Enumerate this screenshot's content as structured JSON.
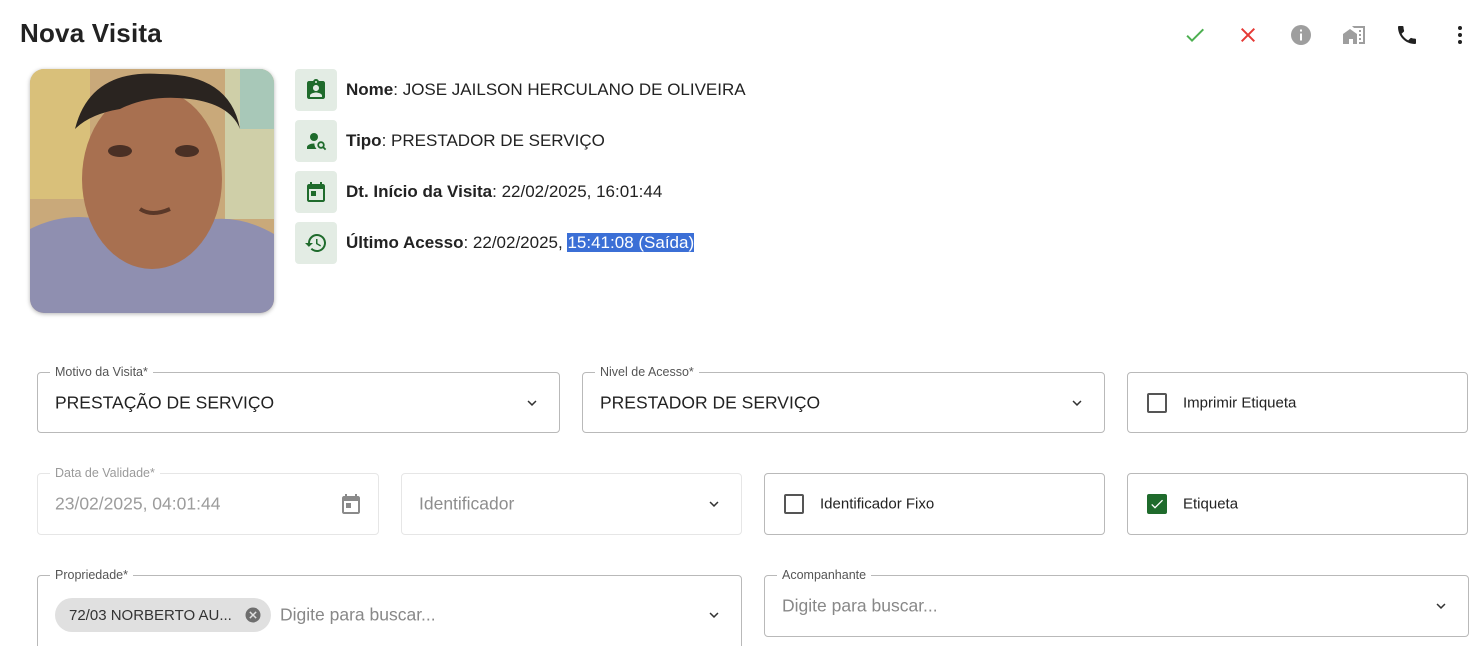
{
  "header": {
    "title": "Nova Visita",
    "actions": [
      "check-icon",
      "close-icon",
      "info-icon",
      "home-work-icon",
      "phone-icon",
      "more-vert-icon"
    ]
  },
  "visitor": {
    "name_label": "Nome",
    "name": "JOSE JAILSON HERCULANO DE OLIVEIRA",
    "type_label": "Tipo",
    "type": "PRESTADOR DE SERVIÇO",
    "start_label": "Dt. Início da Visita",
    "start": "22/02/2025, 16:01:44",
    "last_label": "Último Acesso",
    "last_prefix": "22/02/2025,",
    "last_selected": "15:41:08 (Saída)"
  },
  "form": {
    "motivo": {
      "label": "Motivo da Visita*",
      "value": "PRESTAÇÃO DE SERVIÇO"
    },
    "nivel": {
      "label": "Nivel de Acesso*",
      "value": "PRESTADOR DE SERVIÇO"
    },
    "imprimir": {
      "label": "Imprimir Etiqueta",
      "checked": false
    },
    "validade": {
      "label": "Data de Validade*",
      "value": "23/02/2025, 04:01:44"
    },
    "identificador": {
      "placeholder": "Identificador"
    },
    "ident_fixo": {
      "label": "Identificador Fixo",
      "checked": false
    },
    "etiqueta": {
      "label": "Etiqueta",
      "checked": true
    },
    "propriedade": {
      "label": "Propriedade*",
      "chip": "72/03 NORBERTO AU...",
      "placeholder": "Digite para buscar..."
    },
    "acompanhante": {
      "label": "Acompanhante",
      "placeholder": "Digite para buscar..."
    }
  },
  "colors": {
    "accent_green": "#1f6b2c",
    "check_green": "#4caf50",
    "close_red": "#e53935",
    "icon_tile": "#e3ece4",
    "selection": "#3b6fd6"
  }
}
